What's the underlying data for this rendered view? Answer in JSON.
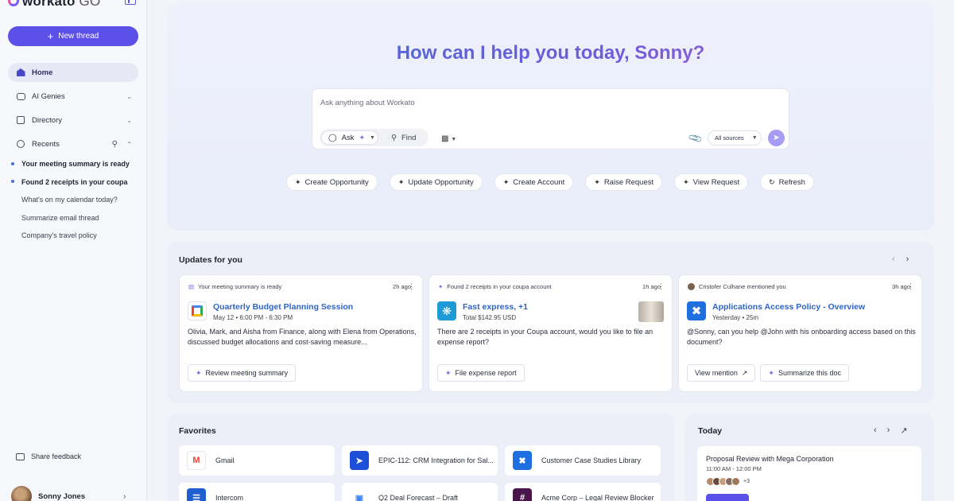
{
  "brand": {
    "name": "workato",
    "suffix": "GO"
  },
  "sidebar": {
    "new_thread": "New thread",
    "nav": [
      {
        "label": "Home"
      },
      {
        "label": "AI Genies"
      },
      {
        "label": "Directory"
      },
      {
        "label": "Recents"
      }
    ],
    "recents": [
      {
        "label": "Your meeting summary is ready",
        "unread": true
      },
      {
        "label": "Found 2 receipts in your coupa",
        "unread": true
      },
      {
        "label": "What's on my calendar today?",
        "unread": false
      },
      {
        "label": "Summarize email thread",
        "unread": false
      },
      {
        "label": "Company's travel policy",
        "unread": false
      }
    ],
    "feedback": "Share feedback",
    "user": "Sonny Jones"
  },
  "hero": {
    "title": "How can I help you today, Sonny?",
    "placeholder": "Ask anything about Workato",
    "mode_ask": "Ask",
    "mode_find": "Find",
    "sources": "All sources",
    "quick_actions": [
      {
        "label": "Create Opportunity"
      },
      {
        "label": "Update Opportunity"
      },
      {
        "label": "Create Account"
      },
      {
        "label": "Raise Request"
      },
      {
        "label": "View Request"
      },
      {
        "label": "Refresh"
      }
    ]
  },
  "updates": {
    "title": "Updates for you",
    "cards": [
      {
        "source": "Your meeting summary is ready",
        "time": "2h ago",
        "title": "Quarterly Budget Planning Session",
        "meta": "May 12  •  6:00 PM - 6:30 PM",
        "body": "Olivia, Mark, and Aisha from Finance, along with Elena from Operations, discussed budget allocations and cost-saving measure...",
        "actions": [
          "Review meeting summary"
        ]
      },
      {
        "source": "Found 2 receipts in your coupa account",
        "time": "1h ago",
        "title": "Fast express, +1",
        "meta": "Total $142.95 USD",
        "body": "There are 2 receipts in your Coupa account, would you like to file an expense report?",
        "actions": [
          "File expense report"
        ]
      },
      {
        "source": "Cristofer Culhane mentioned you",
        "time": "3h ago",
        "title": "Applications Access Policy - Overview",
        "meta": "Yesterday  •  25m",
        "body": "@Sonny, can you help @John with his onboarding access based on this document?",
        "actions": [
          "View mention",
          "Summarize this doc"
        ]
      }
    ]
  },
  "favorites": {
    "title": "Favorites",
    "items": [
      {
        "label": "Gmail"
      },
      {
        "label": "EPIC-112: CRM Integration for Sal..."
      },
      {
        "label": "Customer Case Studies Library"
      },
      {
        "label": "Intercom"
      },
      {
        "label": "Q2 Deal Forecast – Draft"
      },
      {
        "label": "Acme Corp – Legal Review Blocker"
      }
    ]
  },
  "today": {
    "title": "Today",
    "event_title": "Proposal Review with Mega Corporation",
    "event_time": "11:00 AM - 12:00 PM",
    "extra_attendees": "+3"
  },
  "colors": {
    "accent": "#5b50e8",
    "link": "#2e64c8"
  }
}
